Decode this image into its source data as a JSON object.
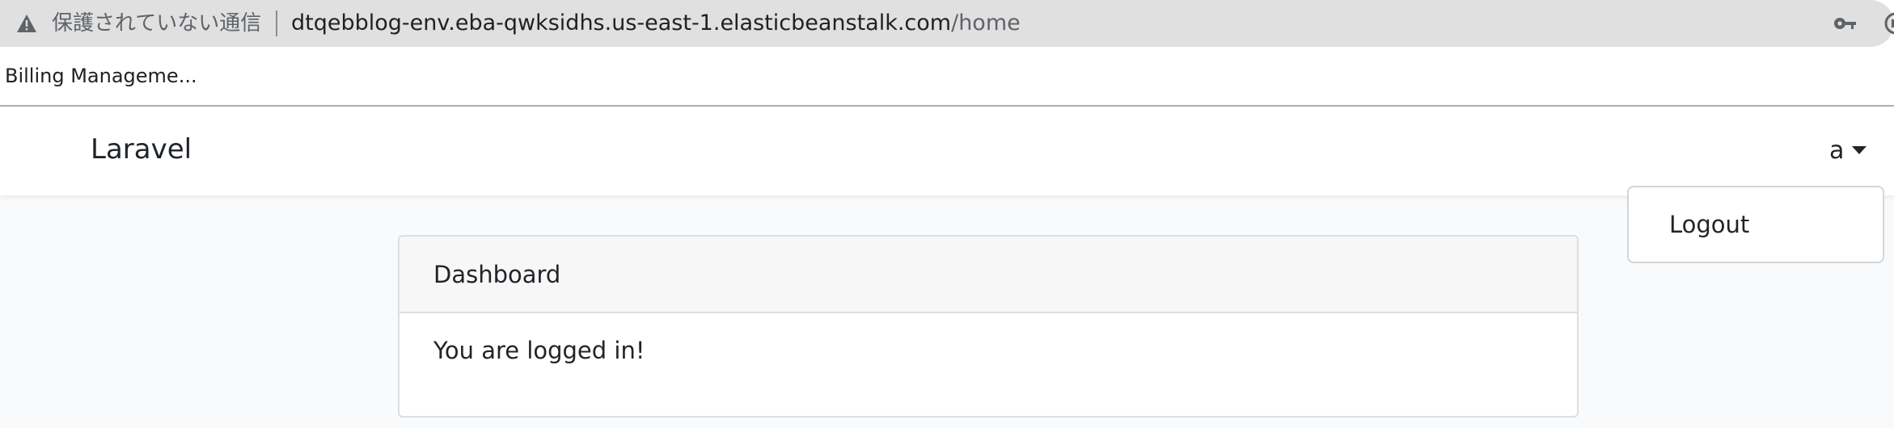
{
  "browser": {
    "security_label": "保護されていない通信",
    "url_host": "dtqebblog-env.eba-qwksidhs.us-east-1.elasticbeanstalk.com",
    "url_path": "/home",
    "icons": [
      "warning-icon",
      "key-icon",
      "extension-icon"
    ]
  },
  "bookmarks": {
    "items": [
      {
        "label": "Billing Manageme..."
      }
    ]
  },
  "navbar": {
    "brand": "Laravel",
    "user_name": "a",
    "dropdown": {
      "items": [
        {
          "label": "Logout"
        }
      ]
    }
  },
  "card": {
    "header": "Dashboard",
    "body": "You are logged in!"
  }
}
